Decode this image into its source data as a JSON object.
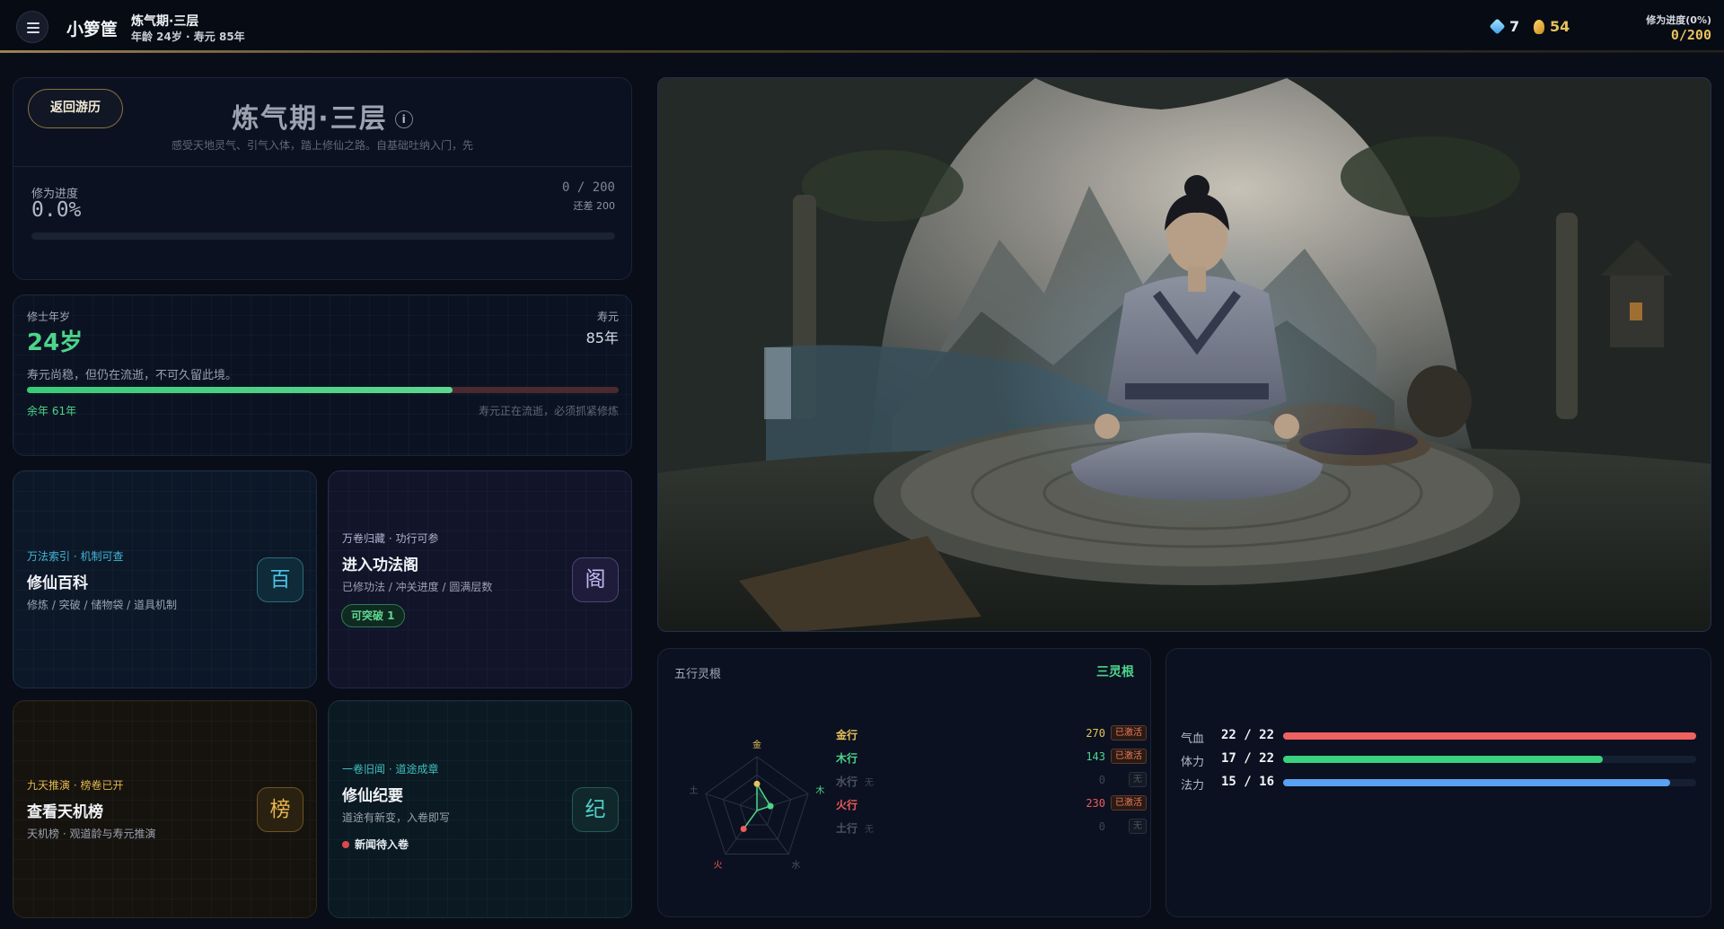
{
  "header": {
    "player_name": "小箩筐",
    "realm": "炼气期·三层",
    "age_line": "年龄 24岁 · 寿元 85年",
    "gems": "7",
    "gold": "54",
    "xiuwei_label": "修为进度(0%)",
    "xiuwei_value": "0/200"
  },
  "realm_panel": {
    "back_label": "返回游历",
    "title": "炼气期·三层",
    "info": "i",
    "desc": "感受天地灵气、引气入体，踏上修仙之路。自基础吐纳入门，先",
    "progress_label": "修为进度",
    "progress_pct": "0.0%",
    "progress_count": "0 / 200",
    "progress_remain": "还差 200",
    "progress_fraction": 0
  },
  "age_panel": {
    "age_label": "修士年岁",
    "age_value": "24岁",
    "life_label": "寿元",
    "life_value": "85年",
    "note": "寿元尚稳，但仍在流逝，不可久留此境。",
    "remaining_fraction": 0.72,
    "remaining_label": "余年  61年",
    "warning": "寿元正在流逝，必须抓紧修炼"
  },
  "cards": {
    "wiki": {
      "tag": "万法索引  ·  机制可查",
      "title": "修仙百科",
      "sub": "修炼 / 突破 / 储物袋 / 道具机制",
      "icon": "百"
    },
    "skills": {
      "tag": "万卷归藏  ·  功行可参",
      "title": "进入功法阁",
      "sub": "已修功法 / 冲关进度 / 圆满层数",
      "pill": "可突破  1",
      "icon": "阁"
    },
    "ranking": {
      "tag": "九天推演  ·  榜卷已开",
      "title": "查看天机榜",
      "sub": "天机榜 · 观道龄与寿元推演",
      "icon": "榜"
    },
    "chronicle": {
      "tag": "一卷旧闻  ·  道途成章",
      "title": "修仙纪要",
      "sub": "道途有新变，入卷即写",
      "note": "新闻待入卷",
      "icon": "纪"
    }
  },
  "wuxing": {
    "title": "五行灵根",
    "type": "三灵根",
    "axis_labels": {
      "jin": "金",
      "mu": "木",
      "shui": "水",
      "huo": "火",
      "tu": "土"
    },
    "rows": [
      {
        "name": "金行",
        "value": "270",
        "badge": "已激活",
        "active": true,
        "color": "#e7c25b"
      },
      {
        "name": "木行",
        "value": "143",
        "badge": "已激活",
        "active": true,
        "color": "#4ed48b"
      },
      {
        "name": "水行",
        "value": "0",
        "badge": "无",
        "active": false,
        "color": "#4b5361",
        "suffix": "无"
      },
      {
        "name": "火行",
        "value": "230",
        "badge": "已激活",
        "active": true,
        "color": "#f05a5a"
      },
      {
        "name": "土行",
        "value": "0",
        "badge": "无",
        "active": false,
        "color": "#4b5361",
        "suffix": "无"
      }
    ]
  },
  "stats": [
    {
      "label": "气血",
      "value": "22 / 22",
      "fraction": 1.0,
      "color": "#ef6161"
    },
    {
      "label": "体力",
      "value": "17 / 22",
      "fraction": 0.773,
      "color": "#3ad17e"
    },
    {
      "label": "法力",
      "value": "15 / 16",
      "fraction": 0.9375,
      "color": "#5aa2f2"
    }
  ]
}
